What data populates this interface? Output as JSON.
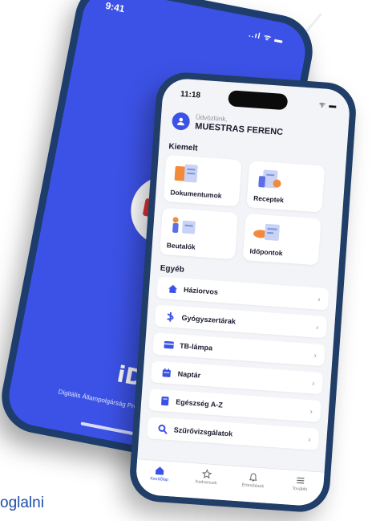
{
  "back_phone": {
    "time": "9:41",
    "status_icons": "..ıl ᯤ ▬",
    "id_logo": "iD",
    "caption": "Digitális Állampolgárság Pro"
  },
  "front_phone": {
    "time": "11:18",
    "status_icons": "ᯤ ▬",
    "greeting_small": "Üdvözlünk,",
    "user_name": "MUESTRAS FERENC",
    "featured_title": "Kiemelt",
    "tiles": [
      {
        "label": "Dokumentumok",
        "icon": "documents-illustration"
      },
      {
        "label": "Receptek",
        "icon": "prescriptions-illustration"
      },
      {
        "label": "Beutalók",
        "icon": "referrals-illustration"
      },
      {
        "label": "Időpontok",
        "icon": "appointments-illustration"
      }
    ],
    "other_title": "Egyéb",
    "rows": [
      {
        "label": "Háziorvos",
        "icon": "house-icon"
      },
      {
        "label": "Gyógyszertárak",
        "icon": "pharmacy-icon"
      },
      {
        "label": "TB-lámpa",
        "icon": "card-icon"
      },
      {
        "label": "Naptár",
        "icon": "calendar-icon"
      },
      {
        "label": "Egészség A-Z",
        "icon": "book-icon"
      },
      {
        "label": "Szűrővizsgálatok",
        "icon": "search-icon"
      }
    ],
    "chevron": "›",
    "tabs": [
      {
        "label": "Kezdőlap",
        "icon": "home-icon",
        "active": true
      },
      {
        "label": "Kedvencek",
        "icon": "star-icon",
        "active": false
      },
      {
        "label": "Értesítések",
        "icon": "bell-icon",
        "active": false
      },
      {
        "label": "További",
        "icon": "menu-icon",
        "active": false
      }
    ]
  },
  "bottom_text": "oglalni",
  "colors": {
    "brand_blue": "#3c52e6",
    "frame": "#203e68",
    "bottom_text": "#1f4ea8"
  }
}
